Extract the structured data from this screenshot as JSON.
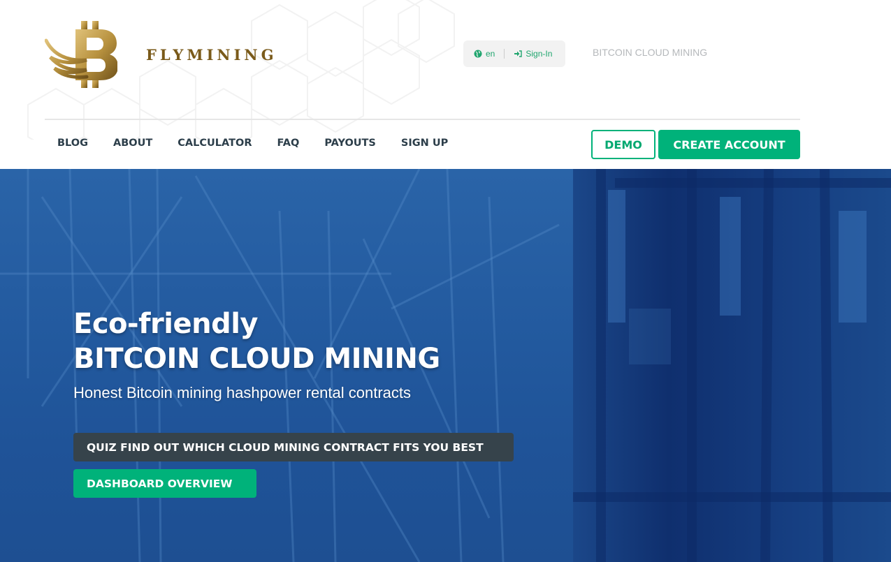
{
  "brand": {
    "name": "FLYMINING",
    "logo_icon": "bitcoin-wing-logo",
    "gold_color": "#b08a36"
  },
  "topbar": {
    "language": {
      "icon": "globe-icon",
      "label": "en"
    },
    "signin": {
      "icon": "sign-in-icon",
      "label": "Sign-In"
    },
    "tagline": "BITCOIN CLOUD MINING"
  },
  "nav": {
    "items": [
      {
        "label": "BLOG"
      },
      {
        "label": "ABOUT"
      },
      {
        "label": "CALCULATOR"
      },
      {
        "label": "FAQ"
      },
      {
        "label": "PAYOUTS"
      },
      {
        "label": "SIGN UP"
      }
    ],
    "demo_label": "DEMO",
    "create_account_label": "CREATE ACCOUNT"
  },
  "hero": {
    "title_line1": "Eco-friendly",
    "title_line2": "BITCOIN CLOUD MINING",
    "subtitle": "Honest Bitcoin mining hashpower rental contracts",
    "quiz_button": "QUIZ FIND OUT WHICH CLOUD MINING CONTRACT FITS YOU BEST",
    "dashboard_button": "DASHBOARD OVERVIEW"
  },
  "colors": {
    "accent_green": "#00b27a",
    "nav_text": "#2c3e4a",
    "quiz_button_bg": "#36434b",
    "hero_blue": "#22599e"
  }
}
